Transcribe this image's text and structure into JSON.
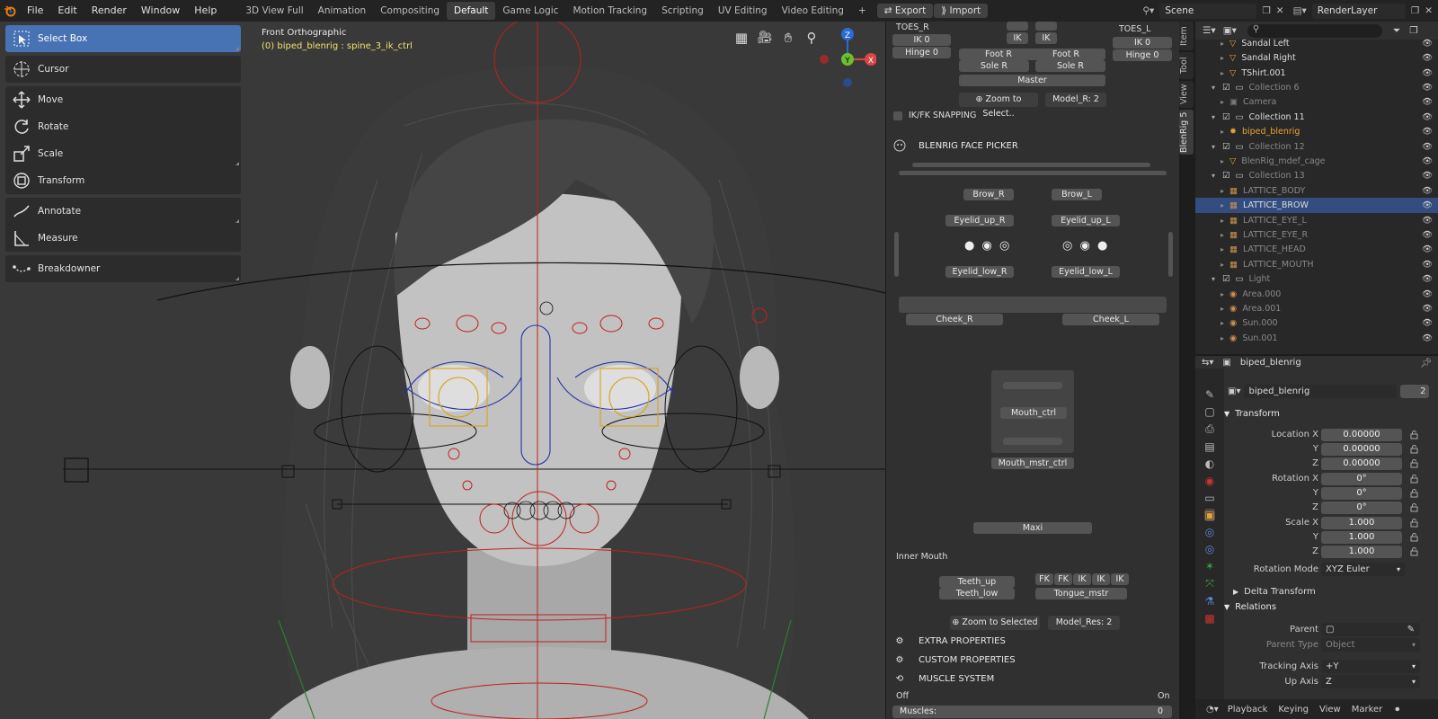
{
  "menu": {
    "file": "File",
    "edit": "Edit",
    "render": "Render",
    "window": "Window",
    "help": "Help"
  },
  "workspaces": [
    "3D View Full",
    "Animation",
    "Compositing",
    "Default",
    "Game Logic",
    "Motion Tracking",
    "Scripting",
    "UV Editing",
    "Video Editing"
  ],
  "active_workspace": "Default",
  "toolbar": {
    "add_tab": "+",
    "export": "Export",
    "import": "Import",
    "scene": "Scene",
    "view_layer": "RenderLayer"
  },
  "tools": {
    "select_box": "Select Box",
    "cursor": "Cursor",
    "move": "Move",
    "rotate": "Rotate",
    "scale": "Scale",
    "transform": "Transform",
    "annotate": "Annotate",
    "measure": "Measure",
    "breakdowner": "Breakdowner"
  },
  "viewport": {
    "view_name": "Front Orthographic",
    "active_object": "(0) biped_blenrig : spine_3_ik_ctrl",
    "gizmo_x": "X",
    "gizmo_y": "Y",
    "gizmo_z": "Z"
  },
  "colors": {
    "accent": "#4772b3",
    "rig_red": "#c0201c",
    "rig_blue": "#2634a8",
    "rig_yellow": "#d8a31a",
    "selected_orange": "#f0a030"
  },
  "picker": {
    "toes_r": "TOES_R",
    "toes_l": "TOES_L",
    "ik0_l": "IK 0",
    "hinge0_l": "Hinge 0",
    "ik0_r": "IK 0",
    "hinge0_r": "Hinge 0",
    "ik_a": "IK",
    "ik_b": "IK",
    "foot_r1": "Foot R",
    "foot_r2": "Foot R",
    "sole_r1": "Sole R",
    "sole_r2": "Sole R",
    "master": "Master",
    "zoom1": "Zoom to Select..",
    "model_r": "Model_R: 2",
    "ikfk": "IK/FK SNAPPING",
    "face_picker": "BLENRIG FACE PICKER",
    "brow_r": "Brow_R",
    "brow_l": "Brow_L",
    "eyelid_up_r": "Eyelid_up_R",
    "eyelid_up_l": "Eyelid_up_L",
    "eyelid_low_r": "Eyelid_low_R",
    "eyelid_low_l": "Eyelid_low_L",
    "cheek_r": "Cheek_R",
    "cheek_l": "Cheek_L",
    "mouth_ctrl": "Mouth_ctrl",
    "mouth_mstr": "Mouth_mstr_ctrl",
    "maxi": "Maxi",
    "inner_mouth": "Inner Mouth",
    "teeth_up": "Teeth_up",
    "teeth_low": "Teeth_low",
    "tongue": "Tongue_mstr",
    "fk1": "FK",
    "fk2": "FK",
    "ik1": "IK",
    "ik2": "IK",
    "ik3": "IK",
    "zoom2": "Zoom to Selected",
    "model_res": "Model_Res: 2",
    "extra": "EXTRA PROPERTIES",
    "custom": "CUSTOM PROPERTIES",
    "muscle": "MUSCLE SYSTEM",
    "off": "Off",
    "on": "On",
    "muscles_label": "Muscles:",
    "muscles_value": "0"
  },
  "side_tabs": [
    "Item",
    "Tool",
    "View",
    "BlenRig 5"
  ],
  "outliner": {
    "rows": [
      {
        "name": "Sandal Left",
        "indent": 2,
        "type": "mesh"
      },
      {
        "name": "Sandal Right",
        "indent": 2,
        "type": "mesh"
      },
      {
        "name": "TShirt.001",
        "indent": 2,
        "type": "mesh"
      },
      {
        "name": "Collection 6",
        "indent": 1,
        "type": "collection",
        "dim": true
      },
      {
        "name": "Camera",
        "indent": 2,
        "type": "camera",
        "dim": true
      },
      {
        "name": "Collection 11",
        "indent": 1,
        "type": "collection"
      },
      {
        "name": "biped_blenrig",
        "indent": 2,
        "type": "armature",
        "active": true
      },
      {
        "name": "Collection 12",
        "indent": 1,
        "type": "collection",
        "dim": true
      },
      {
        "name": "BlenRig_mdef_cage",
        "indent": 2,
        "type": "mesh",
        "dim": true
      },
      {
        "name": "Collection 13",
        "indent": 1,
        "type": "collection",
        "dim": true
      },
      {
        "name": "LATTICE_BODY",
        "indent": 2,
        "type": "lattice",
        "dim": true
      },
      {
        "name": "LATTICE_BROW",
        "indent": 2,
        "type": "lattice",
        "selected": true
      },
      {
        "name": "LATTICE_EYE_L",
        "indent": 2,
        "type": "lattice",
        "dim": true
      },
      {
        "name": "LATTICE_EYE_R",
        "indent": 2,
        "type": "lattice",
        "dim": true
      },
      {
        "name": "LATTICE_HEAD",
        "indent": 2,
        "type": "lattice",
        "dim": true
      },
      {
        "name": "LATTICE_MOUTH",
        "indent": 2,
        "type": "lattice",
        "dim": true
      },
      {
        "name": "Light",
        "indent": 1,
        "type": "collection",
        "dim": true
      },
      {
        "name": "Area.000",
        "indent": 2,
        "type": "light",
        "dim": true
      },
      {
        "name": "Area.001",
        "indent": 2,
        "type": "light",
        "dim": true
      },
      {
        "name": "Sun.000",
        "indent": 2,
        "type": "light",
        "dim": true
      },
      {
        "name": "Sun.001",
        "indent": 2,
        "type": "light",
        "dim": true
      }
    ]
  },
  "properties": {
    "header_object": "biped_blenrig",
    "object_name": "biped_blenrig",
    "users": "2",
    "transform": "Transform",
    "location_x_label": "Location X",
    "y": "Y",
    "z": "Z",
    "location": [
      "0.00000",
      "0.00000",
      "0.00000"
    ],
    "rotation_x_label": "Rotation X",
    "rotation": [
      "0°",
      "0°",
      "0°"
    ],
    "scale_x_label": "Scale X",
    "scale": [
      "1.000",
      "1.000",
      "1.000"
    ],
    "rotation_mode_label": "Rotation Mode",
    "rotation_mode": "XYZ Euler",
    "delta": "Delta Transform",
    "relations": "Relations",
    "parent_label": "Parent",
    "parent_type_label": "Parent Type",
    "parent_type": "Object",
    "tracking_axis_label": "Tracking Axis",
    "tracking_axis": "+Y",
    "up_axis_label": "Up Axis",
    "up_axis": "Z"
  },
  "statusbar": {
    "playback": "Playback",
    "keying": "Keying",
    "view": "View",
    "marker": "Marker"
  }
}
